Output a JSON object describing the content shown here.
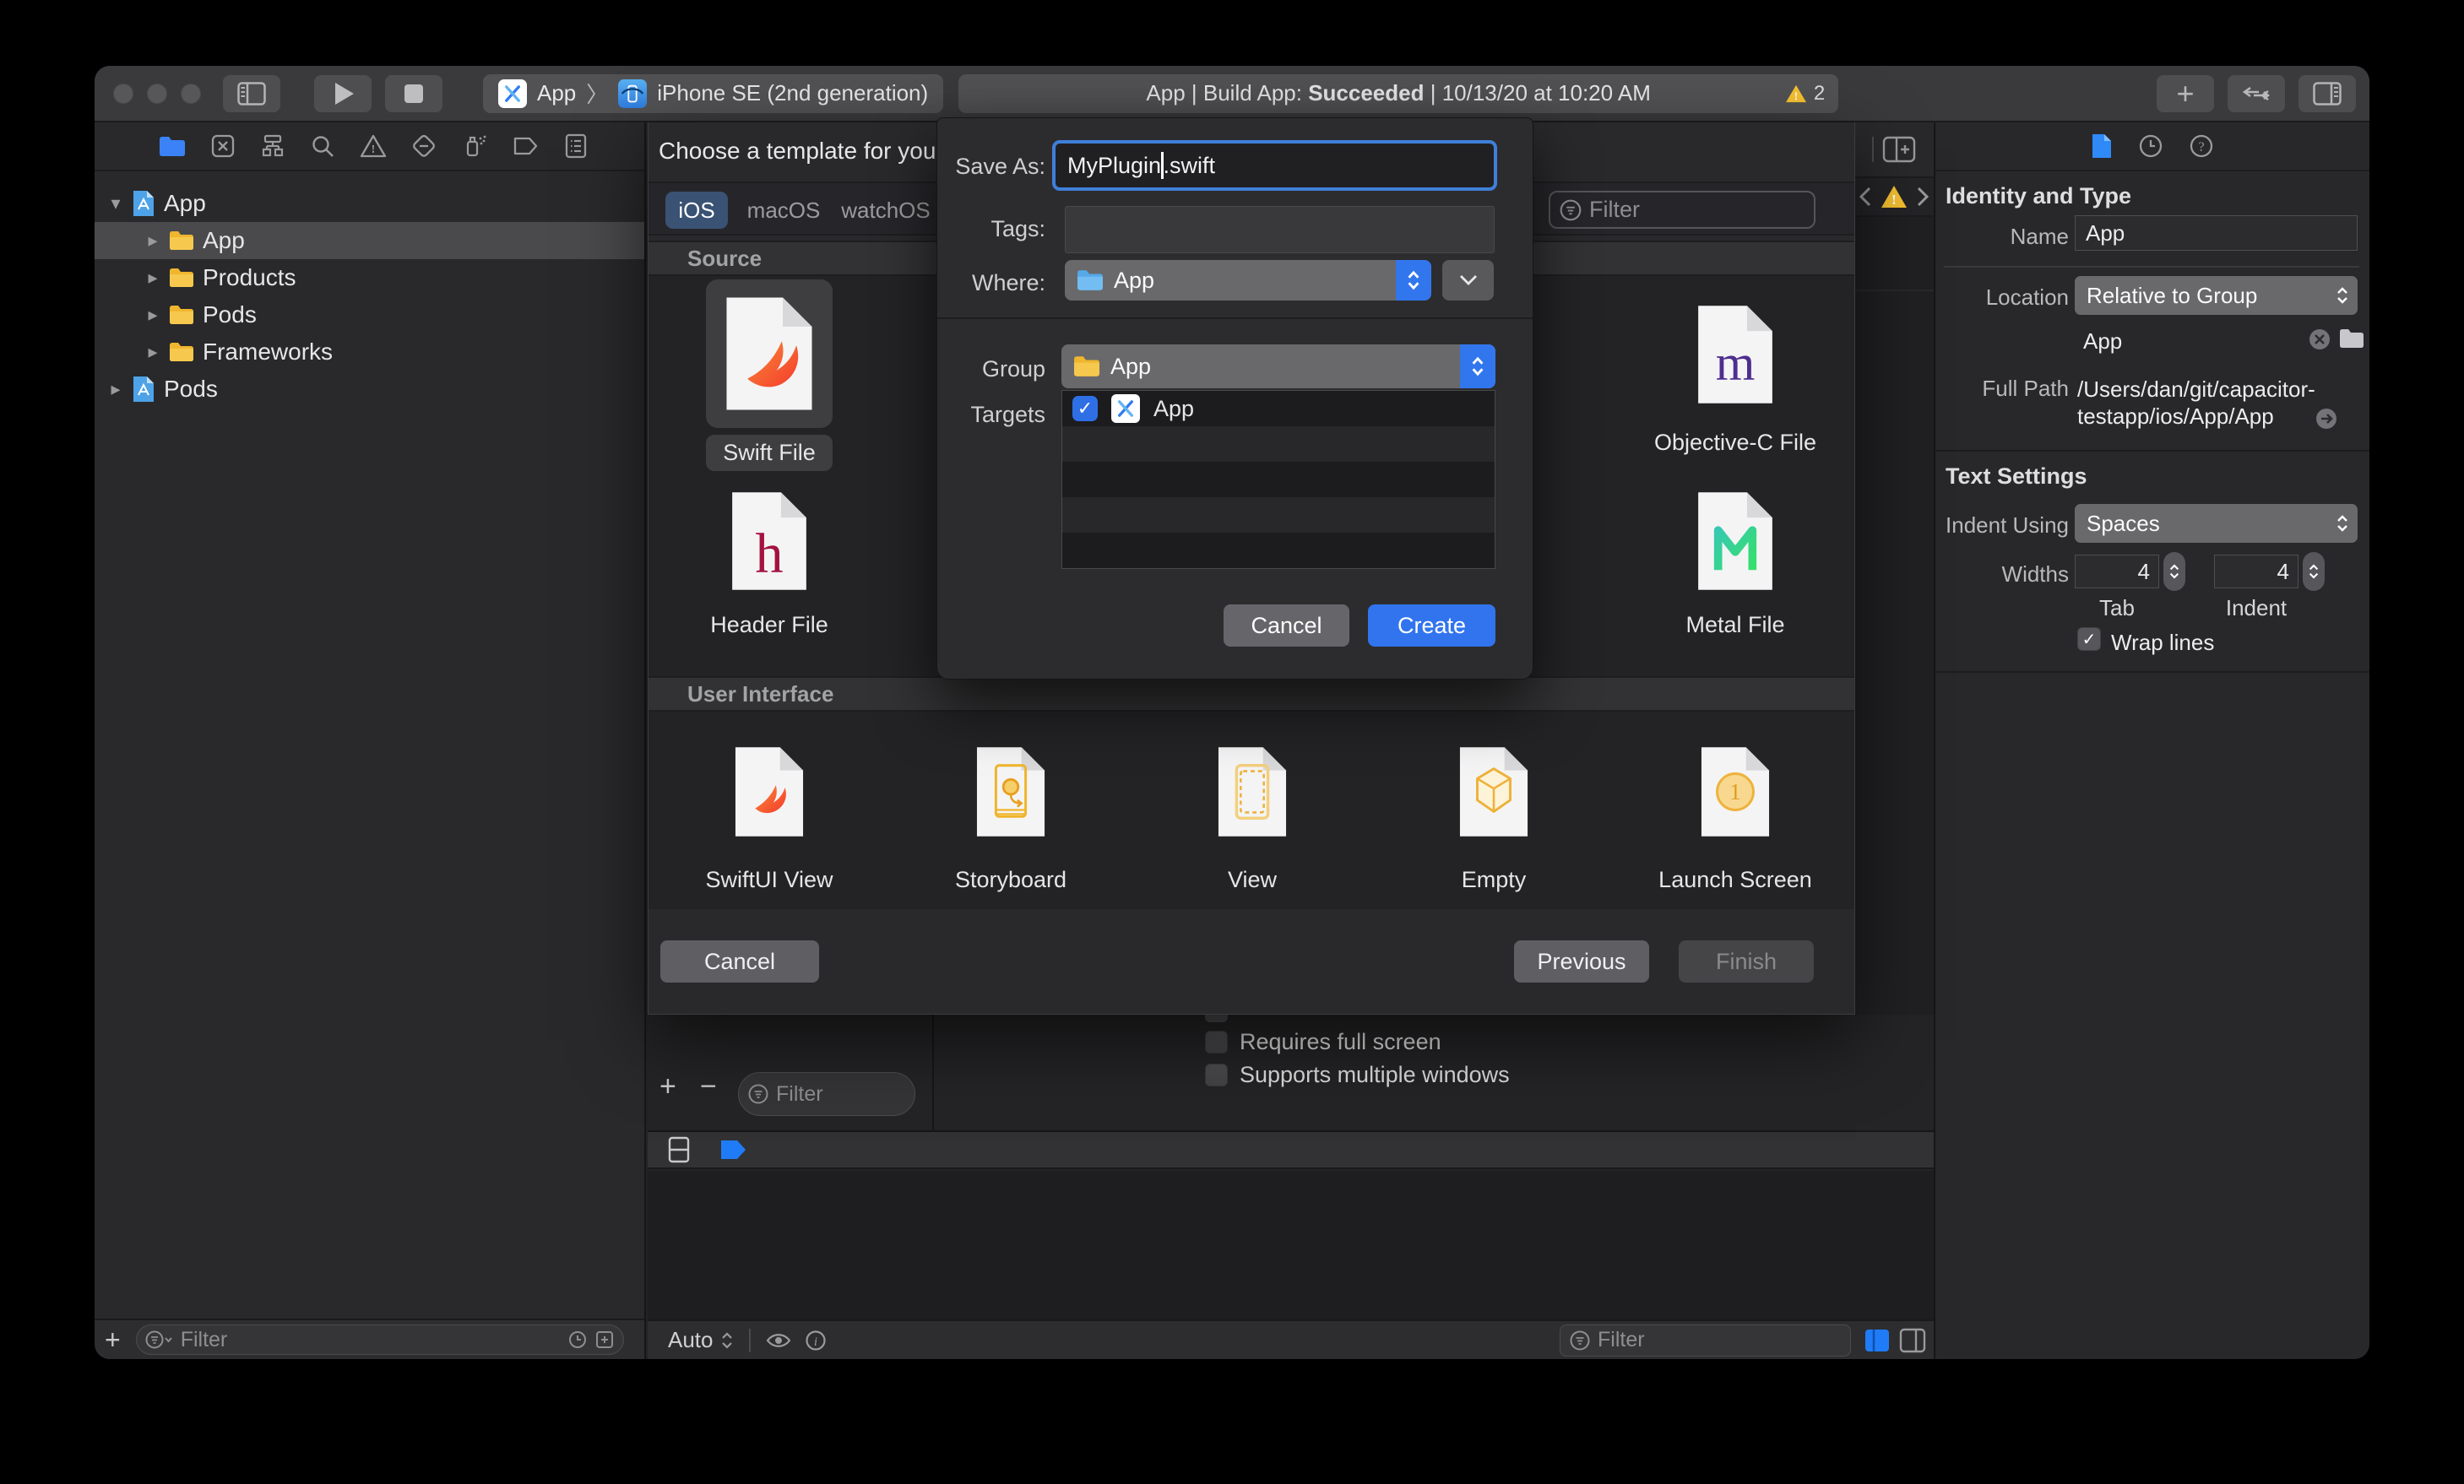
{
  "titlebar": {
    "scheme": {
      "project": "App",
      "chevron": "〉",
      "destination": "iPhone SE (2nd generation)"
    },
    "status": {
      "prefix": "App | Build App: ",
      "status": "Succeeded",
      "suffix": " | 10/13/20 at 10:20 AM",
      "warning_count": "2"
    }
  },
  "navigator": {
    "tree": [
      {
        "label": "App",
        "type": "project",
        "disclosure": "open"
      },
      {
        "label": "App",
        "type": "folder",
        "selected": true
      },
      {
        "label": "Products",
        "type": "folder"
      },
      {
        "label": "Pods",
        "type": "folder"
      },
      {
        "label": "Frameworks",
        "type": "folder"
      },
      {
        "label": "Pods",
        "type": "project"
      }
    ],
    "filter_placeholder": "Filter"
  },
  "template_dialog": {
    "title": "Choose a template for your",
    "tabs": [
      "iOS",
      "macOS",
      "watchOS"
    ],
    "selected_tab": "iOS",
    "filter_placeholder": "Filter",
    "source_section": {
      "header": "Source",
      "items": [
        "Swift File",
        "Header File",
        "Objective-C File",
        "Metal File"
      ],
      "selected": "Swift File"
    },
    "ui_section": {
      "header": "User Interface",
      "items": [
        "SwiftUI View",
        "Storyboard",
        "View",
        "Empty",
        "Launch Screen"
      ]
    },
    "cancel": "Cancel",
    "previous": "Previous",
    "finish": "Finish"
  },
  "save_sheet": {
    "save_as_label": "Save As:",
    "save_as_value": "MyPlugin.swift",
    "save_as_before_caret": "MyPlugin",
    "save_as_after_caret": ".swift",
    "tags_label": "Tags:",
    "where_label": "Where:",
    "where_value": "App",
    "group_label": "Group",
    "group_value": "App",
    "targets_label": "Targets",
    "target_row": {
      "checked": true,
      "check_glyph": "✓",
      "label": "App"
    },
    "cancel": "Cancel",
    "create": "Create"
  },
  "inspector": {
    "identity_heading": "Identity and Type",
    "name_label": "Name",
    "name_value": "App",
    "location_label": "Location",
    "location_value": "Relative to Group",
    "group_value": "App",
    "full_path_label": "Full Path",
    "full_path_line1": "/Users/dan/git/capacitor-",
    "full_path_line2": "testapp/ios/App/App",
    "text_settings_heading": "Text Settings",
    "indent_label": "Indent Using",
    "indent_value": "Spaces",
    "widths_label": "Widths",
    "tab_value": "4",
    "tab_caption": "Tab",
    "indent_width_value": "4",
    "indent_caption": "Indent",
    "wrap_label": "Wrap lines",
    "wrap_checked": true,
    "check_glyph": "✓"
  },
  "editor": {
    "checkbox_rows": [
      {
        "label": "Requires full screen",
        "checked": false
      },
      {
        "label": "Supports multiple windows",
        "checked": false
      }
    ],
    "settings_filter_placeholder": "Filter",
    "bottom_bar": {
      "auto_label": "Auto",
      "filter_placeholder": "Filter"
    }
  },
  "glyphs": {
    "plus": "+",
    "minus": "−"
  },
  "colors": {
    "accent": "#3478f6",
    "warning_yellow": "#f7c231",
    "folder_yellow": "#f0b62f",
    "folder_blue": "#55a9e8",
    "selected_tab_blue": "#3a5273",
    "create_button": "#3174ee"
  }
}
